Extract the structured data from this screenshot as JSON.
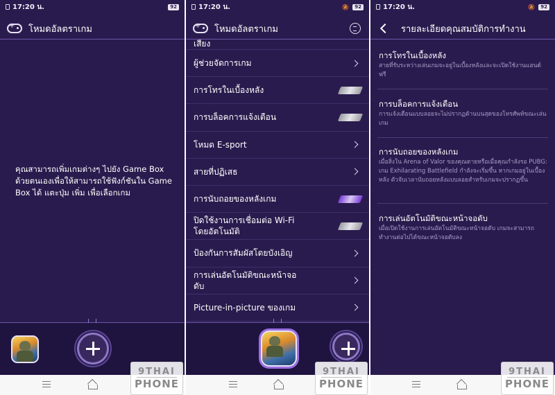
{
  "status": {
    "time": "17:20 น.",
    "battery": "92"
  },
  "header": {
    "title": "โหมดอัลตราเกม",
    "details_title": "รายละเอียดคุณสมบัติการทำงาน"
  },
  "empty_state": {
    "message": "คุณสามารถเพิ่มเกมต่างๆ ไปยัง Game Box ด้วยตนเองเพื่อให้สามารถใช้ฟังก์ชันใน Game Box ได้ แตะปุ่ม เพิ่ม เพื่อเลือกเกม"
  },
  "settings": {
    "partial_item": "เสียง",
    "items": [
      {
        "label": "ผู้ช่วยจัดการเกม",
        "control": "chevron"
      },
      {
        "label": "การโทรในเบื้องหลัง",
        "control": "toggle-off"
      },
      {
        "label": "การบล็อคการแจ้งเตือน",
        "control": "toggle-off"
      },
      {
        "label": "โหมด E-sport",
        "control": "chevron"
      },
      {
        "label": "สายที่ปฏิเสธ",
        "control": "chevron"
      },
      {
        "label": "การนับถอยของหลังเกม",
        "control": "toggle-on"
      },
      {
        "label": "ปิดใช้งานการเชื่อมต่อ Wi-Fi โดยอัตโนมัติ",
        "control": "toggle-off"
      },
      {
        "label": "ป้องกันการสัมผัสโดยบังเอิญ",
        "control": "chevron"
      },
      {
        "label": "การเล่นอัตโนมัติขณะหน้าจอดับ",
        "control": "chevron"
      },
      {
        "label": "Picture-in-picture ของเกม",
        "control": "chevron"
      }
    ]
  },
  "details": [
    {
      "title": "การโทรในเบื้องหลัง",
      "desc": "สายที่รับระหว่างเล่นเกมจะอยู่ในเบื้องหลังและจะเปิดใช้งานแฮนด์ฟรี"
    },
    {
      "title": "การบล็อคการแจ้งเตือน",
      "desc": "การแจ้งเตือนแบบลอยจะไม่ปรากฏด้านบนสุดของโทรศัพท์ขณะเล่นเกม"
    },
    {
      "title": "การนับถอยของหลังเกม",
      "desc": "เมื่อสิ่งใน Arena of Valor ของคุณตายหรือเมื่อคุณกำลังรอ PUBG: เกม Exhilarating Battlefield กำลังจะเริ่มขึ้น หากเกมอยู่ในเบื้องหลัง ตัวจับเวลานับถอยหลังแบบลอยสำหรับเกมจะปรากฏขึ้น"
    },
    {
      "title": "การเล่นอัตโนมัติขณะหน้าจอดับ",
      "desc": "เมื่อเปิดใช้งานการเล่นอัตโนมัติขณะหน้าจอดับ เกมจะสามารถทำงานต่อไปได้ขณะหน้าจอดับลง"
    }
  ],
  "watermark": {
    "line1": "9THAI",
    "line2": "PHONE"
  },
  "colors": {
    "background": "#2a1b4e",
    "dock": "#1f1440",
    "accent": "#8d78c6",
    "toggle_on": "#7b3fd6"
  }
}
